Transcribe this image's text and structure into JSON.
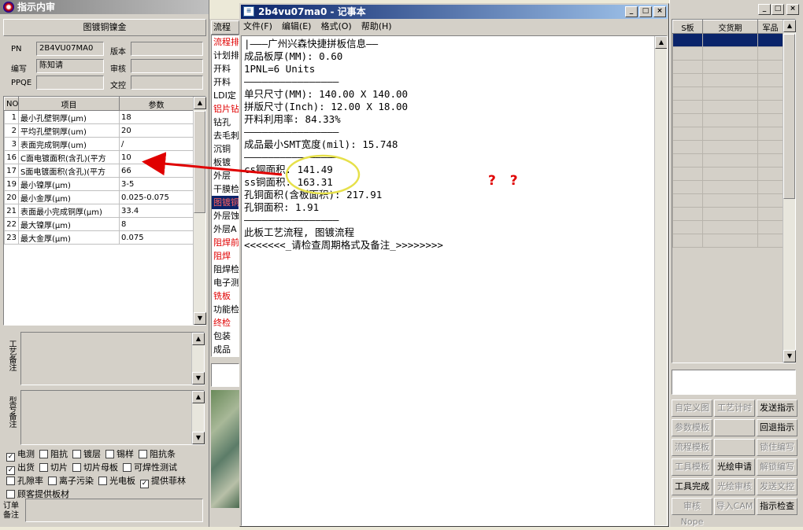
{
  "left_window": {
    "title": "指示内审",
    "header_button": "图镀铜镍金",
    "fields": {
      "pn_label": "PN",
      "pn_value": "2B4VU07MA0",
      "version_label": "版本",
      "writer_label": "编写",
      "writer_value": "陈知请",
      "reviewer_label": "审核",
      "ppqe_label": "PPQE",
      "approver_label": "文控"
    },
    "table": {
      "headers": [
        "NO",
        "项目",
        "参数"
      ],
      "rows": [
        [
          "1",
          "最小孔壁铜厚(μm)",
          "18"
        ],
        [
          "2",
          "平均孔壁铜厚(um)",
          "20"
        ],
        [
          "3",
          "表面完成铜厚(um)",
          "/"
        ],
        [
          "16",
          "C面电镀面积(含孔)(平方",
          "10"
        ],
        [
          "17",
          "S面电镀面积(含孔)(平方",
          "66"
        ],
        [
          "19",
          "最小镍厚(μm)",
          "3-5"
        ],
        [
          "20",
          "最小金厚(μm)",
          "0.025-0.075"
        ],
        [
          "21",
          "表面最小完成铜厚(μm)",
          "33.4"
        ],
        [
          "22",
          "最大镍厚(μm)",
          "8"
        ],
        [
          "23",
          "最大金厚(μm)",
          "0.075"
        ]
      ]
    },
    "process_note_label": "工艺备注",
    "model_note_label": "型号备注",
    "checkboxes": [
      [
        {
          "label": "电测",
          "checked": true
        },
        {
          "label": "阻抗",
          "checked": false
        },
        {
          "label": "镀层",
          "checked": false
        },
        {
          "label": "锡样",
          "checked": false
        },
        {
          "label": "阻抗条",
          "checked": false
        }
      ],
      [
        {
          "label": "出货",
          "checked": true
        },
        {
          "label": "切片",
          "checked": false
        },
        {
          "label": "切片母板",
          "checked": false
        },
        {
          "label": "可焊性测试",
          "checked": false
        }
      ],
      [
        {
          "label": "孔隙率",
          "checked": false
        },
        {
          "label": "离子污染",
          "checked": false
        },
        {
          "label": "光电板",
          "checked": false
        },
        {
          "label": "提供菲林",
          "checked": true
        }
      ],
      [
        {
          "label": "顾客提供板材",
          "checked": false
        }
      ]
    ],
    "order_note_label": "订单备注"
  },
  "flow_panel": {
    "header": "流程",
    "items": [
      {
        "label": "流程排",
        "red": true
      },
      {
        "label": "计划排",
        "red": false
      },
      {
        "label": "开料",
        "red": false
      },
      {
        "label": "开料",
        "red": false
      },
      {
        "label": "LDI定",
        "red": false
      },
      {
        "label": "铝片钻",
        "red": true
      },
      {
        "label": "钻孔",
        "red": false
      },
      {
        "label": "去毛刺",
        "red": false
      },
      {
        "label": "沉铜",
        "red": false
      },
      {
        "label": "板镀",
        "red": false
      },
      {
        "label": "外层",
        "red": false
      },
      {
        "label": "干膜检",
        "red": false
      },
      {
        "label": "图镀铜",
        "red": false,
        "selected": true
      },
      {
        "label": "外层蚀",
        "red": false
      },
      {
        "label": "外层A",
        "red": false
      },
      {
        "label": "阻焊前",
        "red": true
      },
      {
        "label": "阻焊",
        "red": true
      },
      {
        "label": "阻焊检",
        "red": false
      },
      {
        "label": "电子测",
        "red": false
      },
      {
        "label": "铣板",
        "red": true
      },
      {
        "label": "功能检",
        "red": false
      },
      {
        "label": "终检",
        "red": true
      },
      {
        "label": "包装",
        "red": false
      },
      {
        "label": "成品",
        "red": false
      }
    ]
  },
  "notepad": {
    "title": "2b4vu07ma0 - 记事本",
    "menu": [
      "文件(F)",
      "编辑(E)",
      "格式(O)",
      "帮助(H)"
    ],
    "lines": [
      "|———广州兴森快捷拼板信息——",
      "成品板厚(MM): 0.60",
      "1PNL=6 Units",
      "————————————————",
      "单只尺寸(MM): 140.00 X 140.00",
      "拼版尺寸(Inch): 12.00 X 18.00",
      "开料利用率: 84.33%",
      "————————————————",
      "成品最小SMT宽度(mil): 15.748",
      "————————————————",
      "cs铜面积: 141.49",
      "ss铜面积: 163.31",
      "孔铜面积(含板面积): 217.91",
      "孔铜面积: 1.91",
      "————————————————",
      "此板工艺流程, 图镀流程",
      "<<<<<<<_请检查周期格式及备注_>>>>>>>>"
    ]
  },
  "annotation": {
    "question_marks": "? ?"
  },
  "right_panel": {
    "headers": [
      "S板",
      "交货期",
      "军品"
    ],
    "buttons": [
      [
        {
          "label": "自定义图",
          "disabled": true
        },
        {
          "label": "工艺计时",
          "disabled": true
        },
        {
          "label": "发送指示",
          "disabled": false
        }
      ],
      [
        {
          "label": "参数模板",
          "disabled": true
        },
        {
          "label": "",
          "disabled": true
        },
        {
          "label": "回退指示",
          "disabled": false
        }
      ],
      [
        {
          "label": "流程模板",
          "disabled": true
        },
        {
          "label": "",
          "disabled": true
        },
        {
          "label": "锁住编写",
          "disabled": true
        }
      ],
      [
        {
          "label": "工具模板",
          "disabled": true
        },
        {
          "label": "光绘申请",
          "disabled": false
        },
        {
          "label": "解锁编写",
          "disabled": true
        }
      ],
      [
        {
          "label": "工具完成",
          "disabled": false
        },
        {
          "label": "光绘审核",
          "disabled": true
        },
        {
          "label": "发送文控",
          "disabled": true
        }
      ],
      [
        {
          "label": "审核Nope",
          "disabled": true
        },
        {
          "label": "导入CAM",
          "disabled": true
        },
        {
          "label": "指示检查",
          "disabled": false
        }
      ]
    ]
  },
  "colors": {
    "titlebar": "#0a246a",
    "annotation_red": "#e00000",
    "ellipse_yellow": "#e6e04a",
    "highlight_row": "#0a246a"
  }
}
